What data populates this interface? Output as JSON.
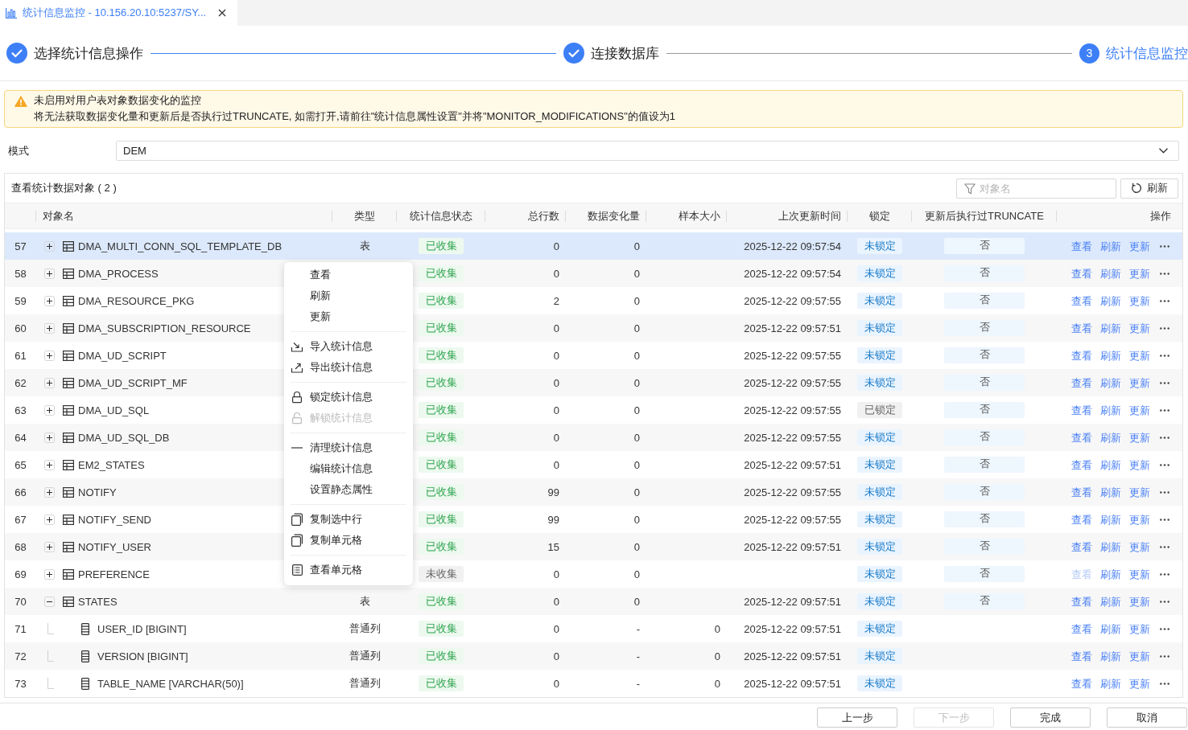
{
  "tab": {
    "title": "统计信息监控 - 10.156.20.10:5237/SY..."
  },
  "steps": [
    {
      "label": "选择统计信息操作",
      "completed": true,
      "current": false
    },
    {
      "label": "连接数据库",
      "completed": true,
      "current": false
    },
    {
      "label": "统计信息监控",
      "completed": false,
      "current": true,
      "number": "3"
    }
  ],
  "warning": {
    "title": "未启用对用户表对象数据变化的监控",
    "message": "将无法获取数据变化量和更新后是否执行过TRUNCATE, 如需打开,请前往\"统计信息属性设置\"并将\"MONITOR_MODIFICATIONS\"的值设为1"
  },
  "mode": {
    "label": "模式",
    "value": "DEM"
  },
  "panel": {
    "title": "查看统计数据对象 ( 2 )",
    "filter": {
      "placeholder": "对象名"
    },
    "refresh_button": "刷新"
  },
  "table": {
    "columns": [
      "对象名",
      "类型",
      "统计信息状态",
      "总行数",
      "数据变化量",
      "样本大小",
      "上次更新时间",
      "锁定",
      "更新后执行过TRUNCATE",
      "操作"
    ],
    "rows": [
      {
        "num": "57",
        "kind": "table",
        "expanded": false,
        "selected": true,
        "name": "DMA_MULTI_CONN_SQL_TEMPLATE_DB",
        "type": "表",
        "status": "已收集",
        "collected": true,
        "total_rows": "0",
        "changes": "0",
        "updated": "2025-12-22 09:57:54",
        "lock": "未锁定",
        "locked": false,
        "truncate": "否",
        "actions": [
          {
            "label": "查看",
            "disabled": false
          },
          {
            "label": "刷新",
            "disabled": false
          },
          {
            "label": "更新",
            "disabled": false
          }
        ]
      },
      {
        "num": "58",
        "kind": "table",
        "expanded": false,
        "selected": false,
        "name": "DMA_PROCESS",
        "status": "已收集",
        "collected": true,
        "total_rows": "0",
        "changes": "0",
        "updated": "2025-12-22 09:57:54",
        "lock": "未锁定",
        "locked": false,
        "truncate": "否",
        "actions": [
          {
            "label": "查看",
            "disabled": false
          },
          {
            "label": "刷新",
            "disabled": false
          },
          {
            "label": "更新",
            "disabled": false
          }
        ]
      },
      {
        "num": "59",
        "kind": "table",
        "expanded": false,
        "selected": false,
        "name": "DMA_RESOURCE_PKG",
        "status": "已收集",
        "collected": true,
        "total_rows": "2",
        "changes": "0",
        "updated": "2025-12-22 09:57:55",
        "lock": "未锁定",
        "locked": false,
        "truncate": "否",
        "actions": [
          {
            "label": "查看",
            "disabled": false
          },
          {
            "label": "刷新",
            "disabled": false
          },
          {
            "label": "更新",
            "disabled": false
          }
        ]
      },
      {
        "num": "60",
        "kind": "table",
        "expanded": false,
        "selected": false,
        "name": "DMA_SUBSCRIPTION_RESOURCE",
        "status": "已收集",
        "collected": true,
        "total_rows": "0",
        "changes": "0",
        "updated": "2025-12-22 09:57:51",
        "lock": "未锁定",
        "locked": false,
        "truncate": "否",
        "actions": [
          {
            "label": "查看",
            "disabled": false
          },
          {
            "label": "刷新",
            "disabled": false
          },
          {
            "label": "更新",
            "disabled": false
          }
        ]
      },
      {
        "num": "61",
        "kind": "table",
        "expanded": false,
        "selected": false,
        "name": "DMA_UD_SCRIPT",
        "status": "已收集",
        "collected": true,
        "total_rows": "0",
        "changes": "0",
        "updated": "2025-12-22 09:57:55",
        "lock": "未锁定",
        "locked": false,
        "truncate": "否",
        "actions": [
          {
            "label": "查看",
            "disabled": false
          },
          {
            "label": "刷新",
            "disabled": false
          },
          {
            "label": "更新",
            "disabled": false
          }
        ]
      },
      {
        "num": "62",
        "kind": "table",
        "expanded": false,
        "selected": false,
        "name": "DMA_UD_SCRIPT_MF",
        "status": "已收集",
        "collected": true,
        "total_rows": "0",
        "changes": "0",
        "updated": "2025-12-22 09:57:55",
        "lock": "未锁定",
        "locked": false,
        "truncate": "否",
        "actions": [
          {
            "label": "查看",
            "disabled": false
          },
          {
            "label": "刷新",
            "disabled": false
          },
          {
            "label": "更新",
            "disabled": false
          }
        ]
      },
      {
        "num": "63",
        "kind": "table",
        "expanded": false,
        "selected": false,
        "name": "DMA_UD_SQL",
        "status": "已收集",
        "collected": true,
        "total_rows": "0",
        "changes": "0",
        "updated": "2025-12-22 09:57:55",
        "lock": "已锁定",
        "locked": true,
        "truncate": "否",
        "actions": [
          {
            "label": "查看",
            "disabled": false
          },
          {
            "label": "刷新",
            "disabled": false
          },
          {
            "label": "更新",
            "disabled": false
          }
        ]
      },
      {
        "num": "64",
        "kind": "table",
        "expanded": false,
        "selected": false,
        "name": "DMA_UD_SQL_DB",
        "status": "已收集",
        "collected": true,
        "total_rows": "0",
        "changes": "0",
        "updated": "2025-12-22 09:57:55",
        "lock": "未锁定",
        "locked": false,
        "truncate": "否",
        "actions": [
          {
            "label": "查看",
            "disabled": false
          },
          {
            "label": "刷新",
            "disabled": false
          },
          {
            "label": "更新",
            "disabled": false
          }
        ]
      },
      {
        "num": "65",
        "kind": "table",
        "expanded": false,
        "selected": false,
        "name": "EM2_STATES",
        "status": "已收集",
        "collected": true,
        "total_rows": "0",
        "changes": "0",
        "updated": "2025-12-22 09:57:51",
        "lock": "未锁定",
        "locked": false,
        "truncate": "否",
        "actions": [
          {
            "label": "查看",
            "disabled": false
          },
          {
            "label": "刷新",
            "disabled": false
          },
          {
            "label": "更新",
            "disabled": false
          }
        ]
      },
      {
        "num": "66",
        "kind": "table",
        "expanded": false,
        "selected": false,
        "name": "NOTIFY",
        "status": "已收集",
        "collected": true,
        "total_rows": "99",
        "changes": "0",
        "updated": "2025-12-22 09:57:55",
        "lock": "未锁定",
        "locked": false,
        "truncate": "否",
        "actions": [
          {
            "label": "查看",
            "disabled": false
          },
          {
            "label": "刷新",
            "disabled": false
          },
          {
            "label": "更新",
            "disabled": false
          }
        ]
      },
      {
        "num": "67",
        "kind": "table",
        "expanded": false,
        "selected": false,
        "name": "NOTIFY_SEND",
        "status": "已收集",
        "collected": true,
        "total_rows": "99",
        "changes": "0",
        "updated": "2025-12-22 09:57:55",
        "lock": "未锁定",
        "locked": false,
        "truncate": "否",
        "actions": [
          {
            "label": "查看",
            "disabled": false
          },
          {
            "label": "刷新",
            "disabled": false
          },
          {
            "label": "更新",
            "disabled": false
          }
        ]
      },
      {
        "num": "68",
        "kind": "table",
        "expanded": false,
        "selected": false,
        "name": "NOTIFY_USER",
        "status": "已收集",
        "collected": true,
        "total_rows": "15",
        "changes": "0",
        "updated": "2025-12-22 09:57:51",
        "lock": "未锁定",
        "locked": false,
        "truncate": "否",
        "actions": [
          {
            "label": "查看",
            "disabled": false
          },
          {
            "label": "刷新",
            "disabled": false
          },
          {
            "label": "更新",
            "disabled": false
          }
        ]
      },
      {
        "num": "69",
        "kind": "table",
        "expanded": false,
        "selected": false,
        "name": "PREFERENCE",
        "status": "未收集",
        "collected": false,
        "total_rows": "0",
        "changes": "0",
        "lock": "未锁定",
        "locked": false,
        "truncate": "否",
        "actions": [
          {
            "label": "查看",
            "disabled": true
          },
          {
            "label": "刷新",
            "disabled": false
          },
          {
            "label": "更新",
            "disabled": false
          }
        ]
      },
      {
        "num": "70",
        "kind": "table",
        "expanded": true,
        "selected": false,
        "name": "STATES",
        "type": "表",
        "status": "已收集",
        "collected": true,
        "total_rows": "0",
        "changes": "0",
        "updated": "2025-12-22 09:57:51",
        "lock": "未锁定",
        "locked": false,
        "truncate": "否",
        "actions": [
          {
            "label": "查看",
            "disabled": false
          },
          {
            "label": "刷新",
            "disabled": false
          },
          {
            "label": "更新",
            "disabled": false
          }
        ],
        "children": [
          {
            "num": "71",
            "kind": "column",
            "selected": false,
            "name": "USER_ID [BIGINT]",
            "type": "普通列",
            "status": "已收集",
            "collected": true,
            "total_rows": "0",
            "changes": "-",
            "sample_size": "0",
            "updated": "2025-12-22 09:57:51",
            "lock": "未锁定",
            "locked": false,
            "actions": [
              {
                "label": "查看",
                "disabled": false
              },
              {
                "label": "刷新",
                "disabled": false
              },
              {
                "label": "更新",
                "disabled": false
              }
            ]
          },
          {
            "num": "72",
            "kind": "column",
            "selected": false,
            "name": "VERSION [BIGINT]",
            "type": "普通列",
            "status": "已收集",
            "collected": true,
            "total_rows": "0",
            "changes": "-",
            "sample_size": "0",
            "updated": "2025-12-22 09:57:51",
            "lock": "未锁定",
            "locked": false,
            "actions": [
              {
                "label": "查看",
                "disabled": false
              },
              {
                "label": "刷新",
                "disabled": false
              },
              {
                "label": "更新",
                "disabled": false
              }
            ]
          },
          {
            "num": "73",
            "kind": "column",
            "selected": false,
            "name": "TABLE_NAME [VARCHAR(50)]",
            "type": "普通列",
            "status": "已收集",
            "collected": true,
            "total_rows": "0",
            "changes": "-",
            "sample_size": "0",
            "updated": "2025-12-22 09:57:51",
            "lock": "未锁定",
            "locked": false,
            "actions": [
              {
                "label": "查看",
                "disabled": false
              },
              {
                "label": "刷新",
                "disabled": false
              },
              {
                "label": "更新",
                "disabled": false
              }
            ]
          }
        ]
      }
    ]
  },
  "context_menu": {
    "groups": [
      {
        "items": [
          {
            "kind": "plain",
            "label": "查看",
            "disabled": false
          },
          {
            "kind": "plain",
            "label": "刷新",
            "disabled": false
          },
          {
            "kind": "plain",
            "label": "更新",
            "disabled": false
          }
        ]
      },
      {
        "items": [
          {
            "kind": "import",
            "label": "导入统计信息",
            "disabled": false
          },
          {
            "kind": "export",
            "label": "导出统计信息",
            "disabled": false
          }
        ]
      },
      {
        "items": [
          {
            "kind": "lock",
            "label": "锁定统计信息",
            "disabled": false
          },
          {
            "kind": "unlock",
            "label": "解锁统计信息",
            "disabled": true
          }
        ]
      },
      {
        "items": [
          {
            "kind": "clear",
            "label": "清理统计信息",
            "disabled": false
          },
          {
            "kind": "plain",
            "label": "编辑统计信息",
            "disabled": false
          },
          {
            "kind": "plain",
            "label": "设置静态属性",
            "disabled": false
          }
        ]
      },
      {
        "items": [
          {
            "kind": "copy",
            "label": "复制选中行",
            "disabled": false
          },
          {
            "kind": "copy",
            "label": "复制单元格",
            "disabled": false
          }
        ]
      },
      {
        "items": [
          {
            "kind": "cells",
            "label": "查看单元格",
            "disabled": false
          }
        ]
      }
    ]
  },
  "footer_buttons": [
    {
      "label": "上一步",
      "disabled": false
    },
    {
      "label": "下一步",
      "disabled": true
    },
    {
      "label": "完成",
      "disabled": false
    },
    {
      "label": "取消",
      "disabled": false
    }
  ]
}
